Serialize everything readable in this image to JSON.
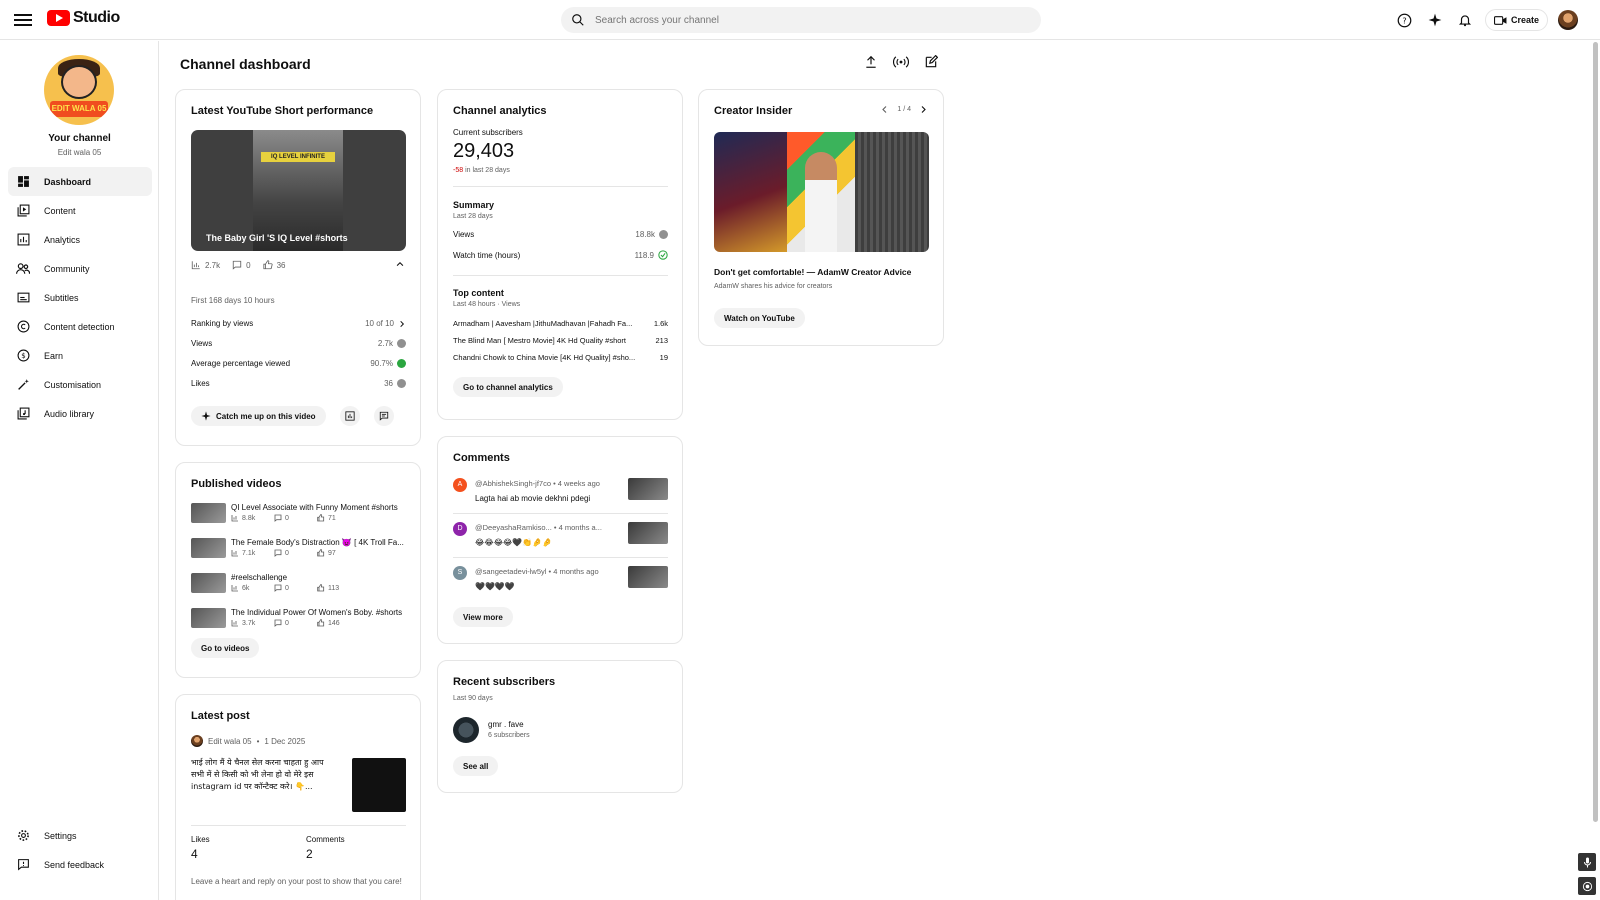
{
  "header": {
    "logo_text": "Studio",
    "search_placeholder": "Search across your channel",
    "create_label": "Create"
  },
  "sidebar": {
    "avatar_badge": "EDIT WALA 05",
    "your_channel": "Your channel",
    "channel_name": "Edit wala 05",
    "items": [
      {
        "label": "Dashboard",
        "icon": "dashboard-icon"
      },
      {
        "label": "Content",
        "icon": "content-icon"
      },
      {
        "label": "Analytics",
        "icon": "analytics-icon"
      },
      {
        "label": "Community",
        "icon": "community-icon"
      },
      {
        "label": "Subtitles",
        "icon": "subtitles-icon"
      },
      {
        "label": "Content detection",
        "icon": "copyright-icon"
      },
      {
        "label": "Earn",
        "icon": "dollar-icon"
      },
      {
        "label": "Customisation",
        "icon": "magic-wand-icon"
      },
      {
        "label": "Audio library",
        "icon": "audio-library-icon"
      }
    ],
    "settings": "Settings",
    "feedback": "Send feedback"
  },
  "main": {
    "title": "Channel dashboard"
  },
  "short_perf": {
    "title": "Latest YouTube Short performance",
    "thumb_tag": "IQ LEVEL INFINITE",
    "video_title": "The Baby Girl 'S IQ Level #shorts",
    "views_short": "2.7k",
    "comments": "0",
    "likes_short": "36",
    "period": "First 168 days 10 hours",
    "rows": [
      {
        "label": "Ranking by views",
        "value": "10 of 10"
      },
      {
        "label": "Views",
        "value": "2.7k"
      },
      {
        "label": "Average percentage viewed",
        "value": "90.7%"
      },
      {
        "label": "Likes",
        "value": "36"
      }
    ],
    "catch_up": "Catch me up on this video"
  },
  "published": {
    "title": "Published videos",
    "videos": [
      {
        "title": "QI Level Associate with Funny Moment #shorts",
        "views": "8.8k",
        "comments": "0",
        "likes": "71"
      },
      {
        "title": "The Female Body's Distraction 👿 [ 4K Troll Fa...",
        "views": "7.1k",
        "comments": "0",
        "likes": "97"
      },
      {
        "title": "#reelschallenge",
        "views": "6k",
        "comments": "0",
        "likes": "113"
      },
      {
        "title": "The Individual Power Of Women's Boby. #shorts",
        "views": "3.7k",
        "comments": "0",
        "likes": "146"
      }
    ],
    "button": "Go to videos"
  },
  "latest_post": {
    "title": "Latest post",
    "author": "Edit wala 05",
    "date": "1 Dec 2025",
    "text": "भाई लोग मैं ये चैनल सेल करना चाहता हु आप सभी में से किसी को भी लेना हो वो मेरे इस instagram id पर कॉन्टैक्ट करे। 👇...",
    "likes_label": "Likes",
    "likes_value": "4",
    "comments_label": "Comments",
    "comments_value": "2",
    "footer": "Leave a heart and reply on your post to show that you care!"
  },
  "analytics": {
    "title": "Channel analytics",
    "subs_label": "Current subscribers",
    "subs_value": "29,403",
    "subs_change": "-58",
    "subs_change_suffix": "in last 28 days",
    "summary_title": "Summary",
    "summary_period": "Last 28 days",
    "summary_rows": [
      {
        "label": "Views",
        "value": "18.8k"
      },
      {
        "label": "Watch time (hours)",
        "value": "118.9"
      }
    ],
    "top_title": "Top content",
    "top_period": "Last 48 hours · Views",
    "top_rows": [
      {
        "title": "Armadham | Aavesham |JithuMadhavan |Fahadh Fa...",
        "value": "1.6k"
      },
      {
        "title": "The Blind Man [ Mestro Movie] 4K Hd Quality #short",
        "value": "213"
      },
      {
        "title": "Chandni Chowk to China Movie [4K Hd Quality] #sho...",
        "value": "19"
      }
    ],
    "button": "Go to channel analytics"
  },
  "comments": {
    "title": "Comments",
    "items": [
      {
        "initial": "A",
        "color": "#f4511e",
        "author": "@AbhishekSingh-jf7co",
        "time": "• 4 weeks ago",
        "text": "Lagta hai ab movie dekhni pdegi"
      },
      {
        "initial": "D",
        "color": "#8e24aa",
        "author": "@DeeyashaRamkiso...",
        "time": "• 4 months a...",
        "text": "😂😂😂😂🖤👏🤌🤌"
      },
      {
        "initial": "S",
        "color": "#78909c",
        "author": "@sangeetadevi-lw5yl",
        "time": "• 4 months ago",
        "text": "🖤🖤🖤🖤"
      }
    ],
    "button": "View more"
  },
  "recent_subs": {
    "title": "Recent subscribers",
    "period": "Last 90 days",
    "name": "gmr . fave",
    "count": "6 subscribers",
    "button": "See all"
  },
  "creator_insider": {
    "title": "Creator Insider",
    "pager": "1 / 4",
    "video_title": "Don't get comfortable! — AdamW Creator Advice",
    "video_sub": "AdamW shares his advice for creators",
    "button": "Watch on YouTube"
  }
}
